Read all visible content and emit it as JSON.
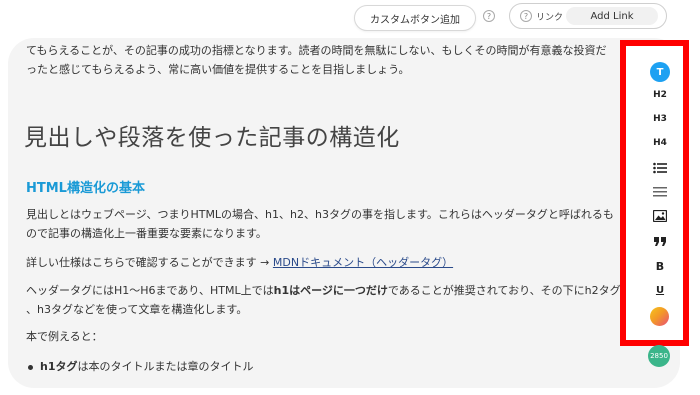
{
  "topbar": {
    "custom_button_label": "カスタムボタン追加",
    "help_glyph": "?",
    "link_label": "リンク",
    "add_link_label": "Add Link"
  },
  "article": {
    "top_line_1": "てもらえることが、その記事の成功の指標となります。読者の時間を無駄にしない、もしくその時間が有意義な投資だ",
    "top_line_2": "ったと感じてもらえるよう、常に高い価値を提供することを目指しましょう。",
    "heading_h2": "見出しや段落を使った記事の構造化",
    "heading_h3": "HTML構造化の基本",
    "para1_line1": "見出しとはウェブページ、つまりHTMLの場合、h1、h2、h3タグの事を指します。これらはヘッダータグと呼ばれるも",
    "para1_line2": "ので記事の構造化上一番重要な要素になります。",
    "para2_text": "詳しい仕様はこちらで確認することができます",
    "para2_arrow": "→",
    "para2_link": "MDNドキュメント（ヘッダータグ）",
    "para3_line1_a": "ヘッダータグにはH1〜H6まであり、HTML上では",
    "para3_line1_b": "h1はページに一つだけ",
    "para3_line1_c": "であることが推奨されており、その下にh2タグ",
    "para3_line2": "、h3タグなどを使って文章を構造化します。",
    "para4": "本で例えると：",
    "bullet1_bold": "h1タグ",
    "bullet1_rest": "は本のタイトルまたは章のタイトル"
  },
  "toolbar": {
    "text_label": "T",
    "h2": "H2",
    "h3": "H3",
    "h4": "H4",
    "bold": "B",
    "underline": "U",
    "colors": {
      "text_button": "#1da1f2",
      "frame": "#ff0000",
      "counter": "#3bb58a"
    },
    "icons": [
      "list-icon",
      "separator-icon",
      "image-icon",
      "quote-icon",
      "color-palette-icon"
    ]
  },
  "counter": "2850"
}
